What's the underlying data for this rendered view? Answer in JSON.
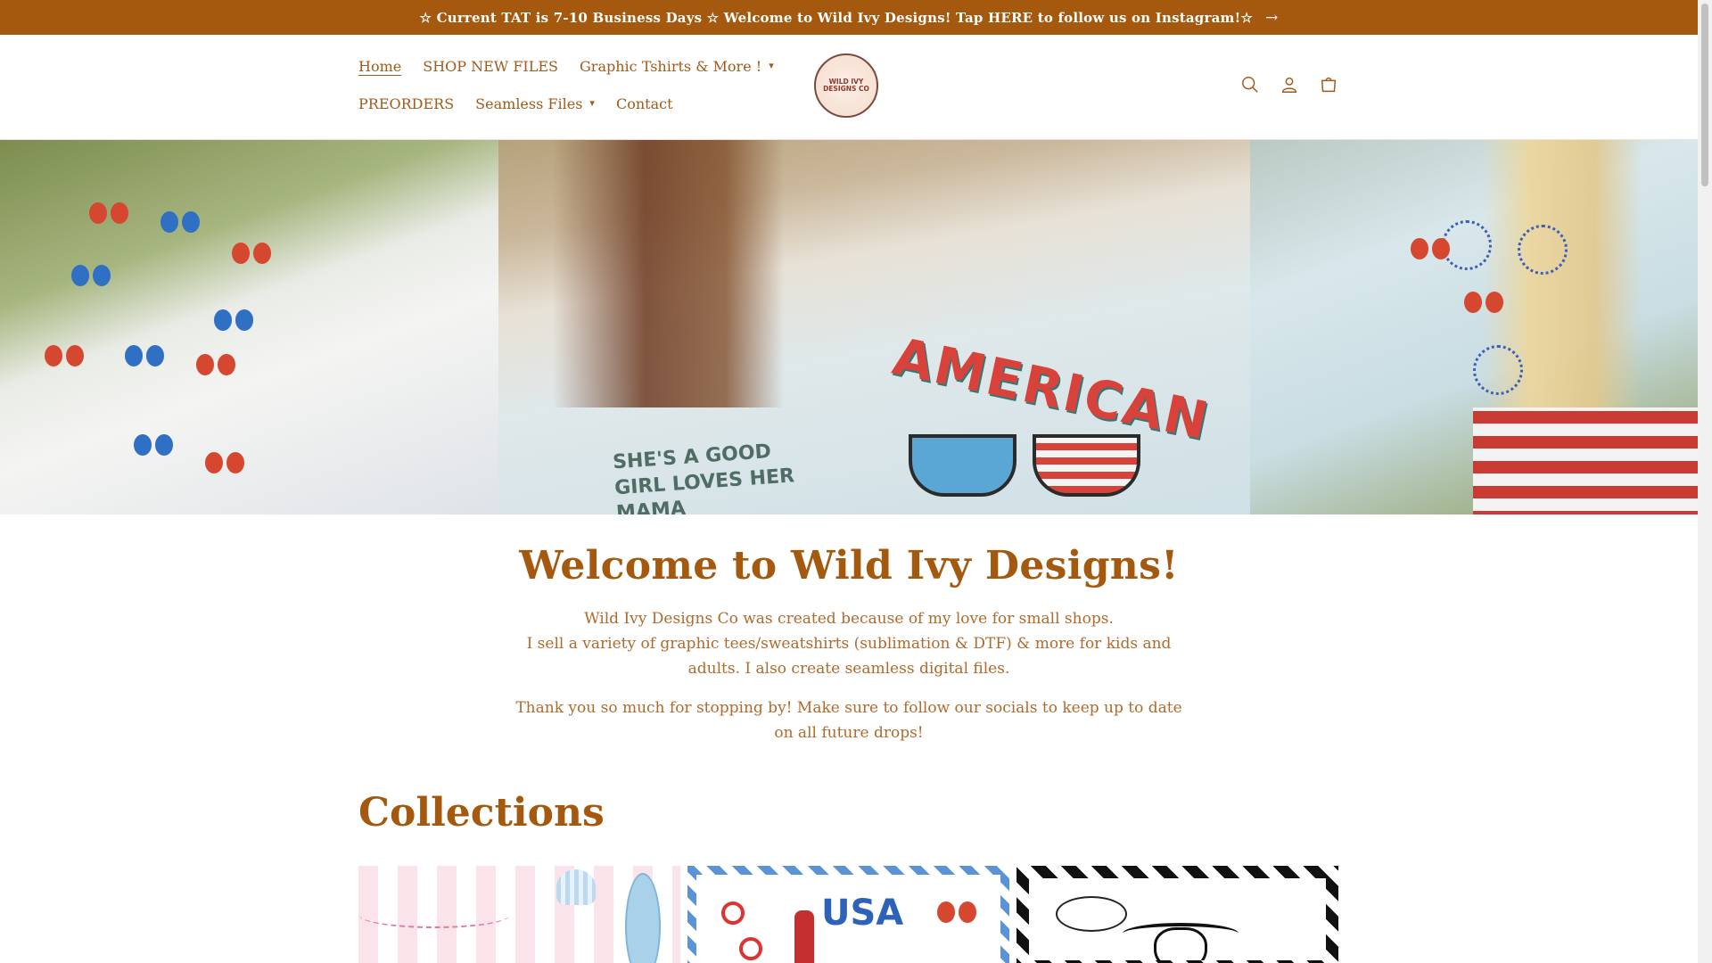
{
  "announcement": {
    "text": "☆ Current TAT is 7-10 Business Days ☆ Welcome to Wild Ivy Designs! Tap HERE to follow us on Instagram!☆",
    "arrow": "→"
  },
  "nav": {
    "row1": [
      {
        "label": "Home",
        "active": true
      },
      {
        "label": "SHOP NEW FILES"
      },
      {
        "label": "Graphic Tshirts & More !",
        "dropdown": true
      }
    ],
    "row2": [
      {
        "label": "PREORDERS"
      },
      {
        "label": "Seamless Files",
        "dropdown": true
      },
      {
        "label": "Contact"
      }
    ],
    "chevron": "⌄"
  },
  "logo": {
    "text": "WILD IVY DESIGNS CO"
  },
  "header_icons": [
    "search-icon",
    "account-icon",
    "cart-icon"
  ],
  "hero": {
    "shirt_text_1": "AMERICAN",
    "shirt_text_2": "SHE'S A GOOD GIRL LOVES HER MAMA"
  },
  "welcome": {
    "title": "Welcome to Wild Ivy Designs!",
    "line1": "Wild Ivy Designs Co was created because of my love for small shops.",
    "line2": "I sell a variety of graphic tees/sweatshirts (sublimation & DTF) & more for kids and adults. I also create seamless digital files.",
    "line3": "Thank you so much for stopping by! Make sure to follow our socials to keep up to date on all future drops!"
  },
  "collections": {
    "title": "Collections",
    "card2_text": "USA"
  },
  "colors": {
    "brand": "#a4590f",
    "text": "#a05a1a"
  }
}
